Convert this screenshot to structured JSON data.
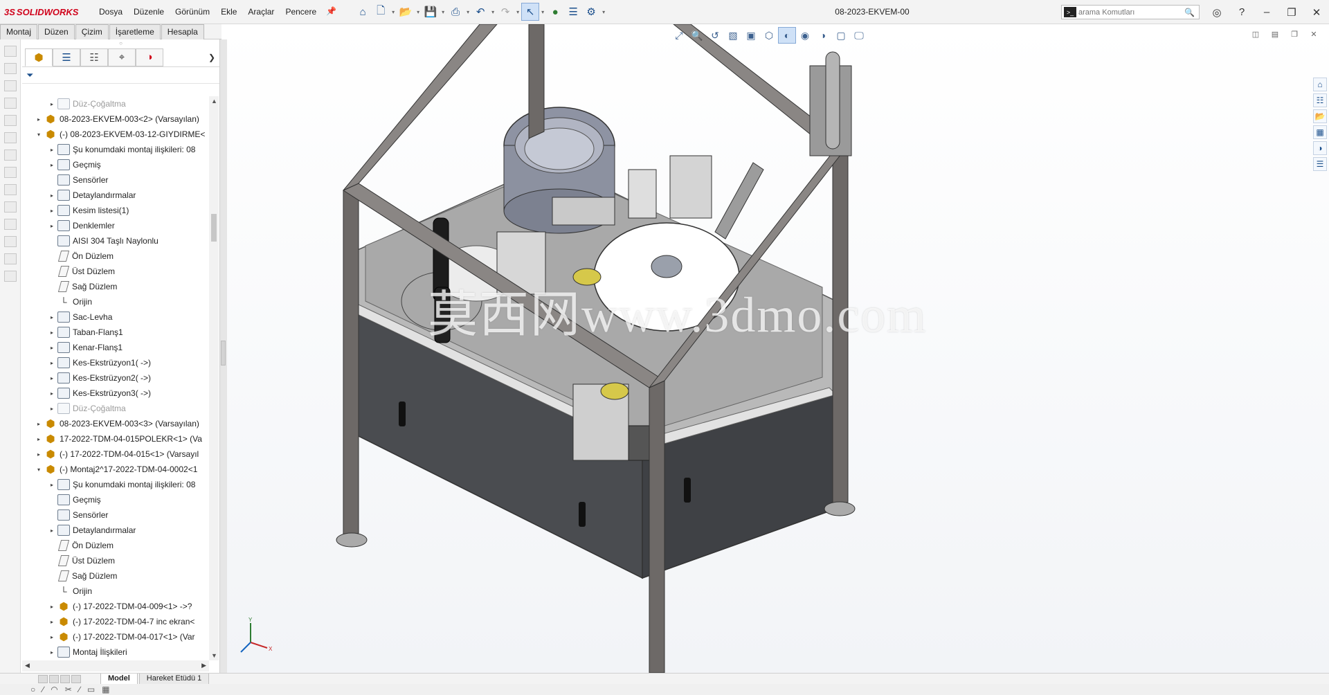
{
  "app": {
    "logo_prefix": "3S",
    "logo_text": "SOLIDWORKS",
    "document_title": "08-2023-EKVEM-00"
  },
  "menu": [
    "Dosya",
    "Düzenle",
    "Görünüm",
    "Ekle",
    "Araçlar",
    "Pencere"
  ],
  "search": {
    "placeholder": "arama Komutları"
  },
  "command_tabs": [
    "Montaj",
    "Düzen",
    "Çizim",
    "İşaretleme",
    "Hesapla"
  ],
  "feature_tree": [
    {
      "label": "Düz-Çoğaltma",
      "indent": 2,
      "icon": "feat",
      "toggle": "▸",
      "dim": true
    },
    {
      "label": "08-2023-EKVEM-003<2> (Varsayılan)",
      "indent": 1,
      "icon": "asm",
      "toggle": "▸"
    },
    {
      "label": "(-) 08-2023-EKVEM-03-12-GIYDIRME<",
      "indent": 1,
      "icon": "asm",
      "toggle": "▾"
    },
    {
      "label": "Şu konumdaki montaj ilişkileri: 08",
      "indent": 2,
      "icon": "feat",
      "toggle": "▸"
    },
    {
      "label": "Geçmiş",
      "indent": 2,
      "icon": "feat",
      "toggle": "▸"
    },
    {
      "label": "Sensörler",
      "indent": 2,
      "icon": "feat",
      "toggle": ""
    },
    {
      "label": "Detaylandırmalar",
      "indent": 2,
      "icon": "feat",
      "toggle": "▸"
    },
    {
      "label": "Kesim listesi(1)",
      "indent": 2,
      "icon": "feat",
      "toggle": "▸"
    },
    {
      "label": "Denklemler",
      "indent": 2,
      "icon": "feat",
      "toggle": "▸"
    },
    {
      "label": "AISI 304 Taşlı Naylonlu",
      "indent": 2,
      "icon": "feat",
      "toggle": ""
    },
    {
      "label": "Ön Düzlem",
      "indent": 2,
      "icon": "plane",
      "toggle": ""
    },
    {
      "label": "Üst Düzlem",
      "indent": 2,
      "icon": "plane",
      "toggle": ""
    },
    {
      "label": "Sağ Düzlem",
      "indent": 2,
      "icon": "plane",
      "toggle": ""
    },
    {
      "label": "Orijin",
      "indent": 2,
      "icon": "orig",
      "toggle": ""
    },
    {
      "label": "Sac-Levha",
      "indent": 2,
      "icon": "feat",
      "toggle": "▸"
    },
    {
      "label": "Taban-Flanş1",
      "indent": 2,
      "icon": "feat",
      "toggle": "▸"
    },
    {
      "label": "Kenar-Flanş1",
      "indent": 2,
      "icon": "feat",
      "toggle": "▸"
    },
    {
      "label": "Kes-Ekstrüzyon1( ->)",
      "indent": 2,
      "icon": "feat",
      "toggle": "▸"
    },
    {
      "label": "Kes-Ekstrüzyon2( ->)",
      "indent": 2,
      "icon": "feat",
      "toggle": "▸"
    },
    {
      "label": "Kes-Ekstrüzyon3( ->)",
      "indent": 2,
      "icon": "feat",
      "toggle": "▸"
    },
    {
      "label": "Düz-Çoğaltma",
      "indent": 2,
      "icon": "feat",
      "toggle": "▸",
      "dim": true
    },
    {
      "label": "08-2023-EKVEM-003<3> (Varsayılan)",
      "indent": 1,
      "icon": "asm",
      "toggle": "▸"
    },
    {
      "label": "17-2022-TDM-04-015POLEKR<1> (Va",
      "indent": 1,
      "icon": "asm",
      "toggle": "▸"
    },
    {
      "label": "(-) 17-2022-TDM-04-015<1> (Varsayıl",
      "indent": 1,
      "icon": "asm",
      "toggle": "▸"
    },
    {
      "label": "(-) Montaj2^17-2022-TDM-04-0002<1",
      "indent": 1,
      "icon": "asm",
      "toggle": "▾"
    },
    {
      "label": "Şu konumdaki montaj ilişkileri: 08",
      "indent": 2,
      "icon": "feat",
      "toggle": "▸"
    },
    {
      "label": "Geçmiş",
      "indent": 2,
      "icon": "feat",
      "toggle": ""
    },
    {
      "label": "Sensörler",
      "indent": 2,
      "icon": "feat",
      "toggle": ""
    },
    {
      "label": "Detaylandırmalar",
      "indent": 2,
      "icon": "feat",
      "toggle": "▸"
    },
    {
      "label": "Ön Düzlem",
      "indent": 2,
      "icon": "plane",
      "toggle": ""
    },
    {
      "label": "Üst Düzlem",
      "indent": 2,
      "icon": "plane",
      "toggle": ""
    },
    {
      "label": "Sağ Düzlem",
      "indent": 2,
      "icon": "plane",
      "toggle": ""
    },
    {
      "label": "Orijin",
      "indent": 2,
      "icon": "orig",
      "toggle": ""
    },
    {
      "label": "(-) 17-2022-TDM-04-009<1> ->?",
      "indent": 2,
      "icon": "asm",
      "toggle": "▸"
    },
    {
      "label": "(-) 17-2022-TDM-04-7 inc ekran<",
      "indent": 2,
      "icon": "asm",
      "toggle": "▸"
    },
    {
      "label": "(-) 17-2022-TDM-04-017<1> (Var",
      "indent": 2,
      "icon": "asm",
      "toggle": "▸"
    },
    {
      "label": "Montaj İlişkileri",
      "indent": 2,
      "icon": "feat",
      "toggle": "▸"
    }
  ],
  "bottom_tabs": [
    "Model",
    "Hareket Etüdü 1"
  ],
  "watermark": "莫西网www.3dmo.com",
  "colors": {
    "brand": "#d0021b",
    "accent": "#1b4f8c"
  }
}
